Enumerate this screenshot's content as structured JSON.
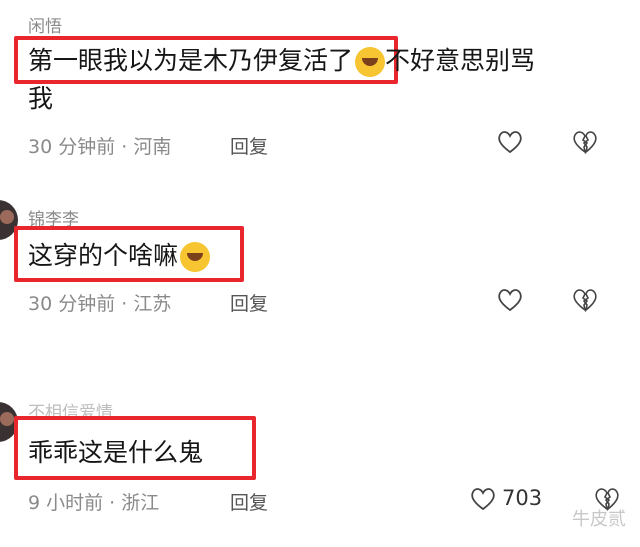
{
  "comments": [
    {
      "username": "闲悟",
      "text_line1_highlight": "第一眼我以为是木乃伊复活了",
      "text_line1_rest": "不好意思别骂",
      "text_line2": "我",
      "meta": "30 分钟前 · 河南",
      "reply": "回复",
      "emoji": "rolling-on-floor-laughing-emoji"
    },
    {
      "username": "锦李李",
      "text": "这穿的个啥嘛",
      "meta": "30 分钟前 · 江苏",
      "reply": "回复",
      "emoji": "covering-face-emoji"
    },
    {
      "username": "不相信爱情",
      "text": "乖乖这是什么鬼",
      "meta": "9 小时前 · 浙江",
      "reply": "回复",
      "like_count": "703"
    }
  ],
  "watermark": "牛皮贰",
  "colors": {
    "highlight": "#e8262c",
    "meta": "#8a8a8a"
  }
}
